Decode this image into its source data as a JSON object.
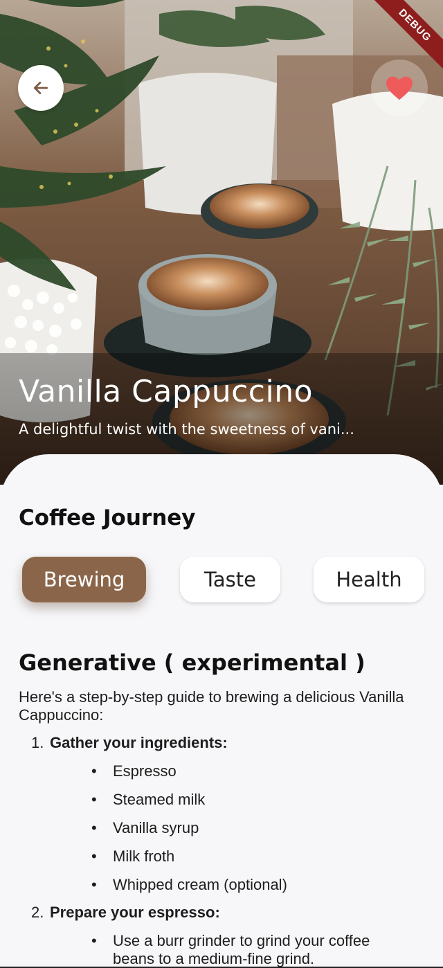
{
  "header": {
    "title": "Vanilla Cappuccino",
    "subtitle": "A delightful twist with the sweetness of vani...",
    "debug_label": "DEBUG",
    "back_icon": "arrow-left-icon",
    "favorite_icon": "heart-icon"
  },
  "colors": {
    "accent": "#8a6549",
    "heart": "#ef5b5b",
    "background": "#f7f7f9"
  },
  "journey": {
    "title": "Coffee Journey",
    "tabs": [
      {
        "label": "Brewing",
        "active": true
      },
      {
        "label": "Taste",
        "active": false
      },
      {
        "label": "Health",
        "active": false
      }
    ]
  },
  "generative": {
    "title": "Generative ( experimental )",
    "intro": "Here's a step-by-step guide to brewing a delicious Vanilla Cappuccino:",
    "steps": [
      {
        "number": "1.",
        "title": "Gather your ingredients:",
        "bullets": [
          "Espresso",
          "Steamed milk",
          "Vanilla syrup",
          "Milk froth",
          "Whipped cream (optional)"
        ]
      },
      {
        "number": "2.",
        "title": "Prepare your espresso:",
        "bullets": [
          "Use a burr grinder to grind your coffee beans to a medium-fine grind."
        ]
      }
    ]
  }
}
